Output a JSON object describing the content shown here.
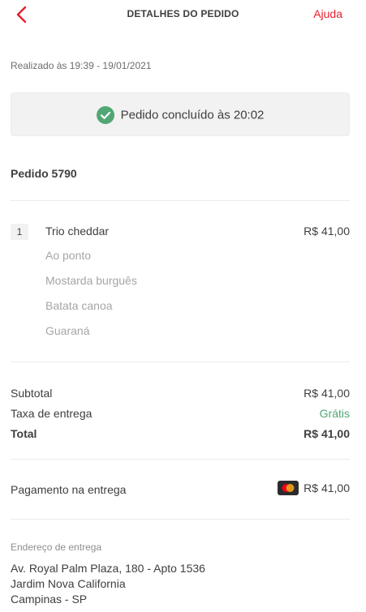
{
  "header": {
    "title": "DETALHES DO PEDIDO",
    "help_label": "Ajuda",
    "back_icon": "chevron-left-icon",
    "accent_color": "#ea1d2c"
  },
  "order": {
    "placed_at": "Realizado às 19:39 - 19/01/2021",
    "status_text": "Pedido concluído às 20:02",
    "status_icon": "check-circle-icon",
    "status_color": "#50a773",
    "number_label": "Pedido 5790"
  },
  "items": [
    {
      "quantity": "1",
      "name": "Trio cheddar",
      "price": "R$ 41,00",
      "options": [
        "Ao ponto",
        "Mostarda burguês",
        "Batata canoa",
        "Guaraná"
      ]
    }
  ],
  "summary": {
    "subtotal_label": "Subtotal",
    "subtotal_value": "R$ 41,00",
    "delivery_label": "Taxa de entrega",
    "delivery_value": "Grátis",
    "total_label": "Total",
    "total_value": "R$ 41,00"
  },
  "payment": {
    "label": "Pagamento na entrega",
    "card_icon": "mastercard-icon",
    "value": "R$ 41,00"
  },
  "address": {
    "label": "Endereço de entrega",
    "line1": "Av. Royal Palm Plaza, 180 - Apto 1536",
    "line2": "Jardim Nova California",
    "line3": "Campinas - SP"
  }
}
